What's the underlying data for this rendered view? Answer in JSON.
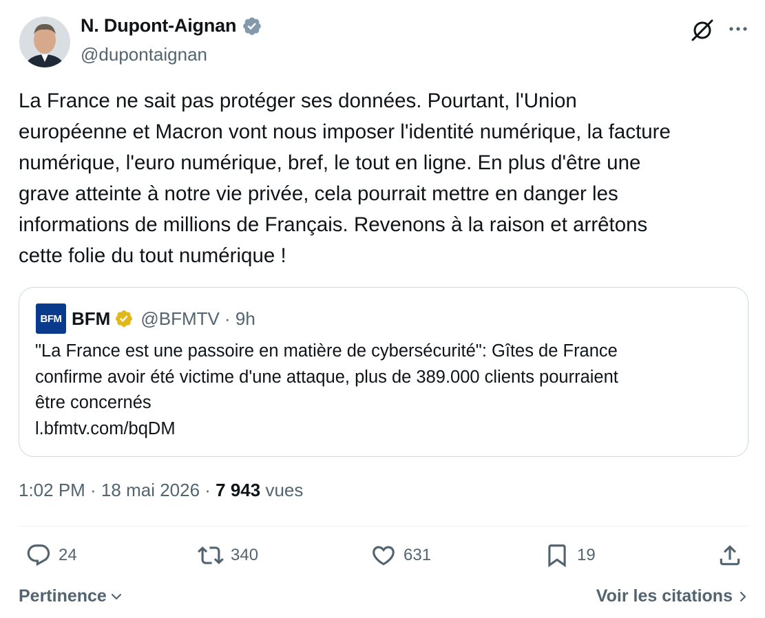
{
  "author": {
    "name": "N. Dupont-Aignan",
    "handle": "@dupontaignan"
  },
  "tweet": {
    "text": "La France ne sait pas protéger ses données. Pourtant, l'Union\neuropéenne et Macron vont nous imposer l'identité numérique, la facture\nnumérique, l'euro numérique, bref, le tout en ligne. En plus d'être une\ngrave atteinte à notre vie privée, cela pourrait mettre en danger les\ninformations de millions de Français. Revenons à la raison et arrêtons\ncette folie du tout numérique !"
  },
  "quote": {
    "logo_text": "BFM",
    "name": "BFM",
    "meta": "@BFMTV · 9h",
    "text": "\"La France est une passoire en matière de cybersécurité\": Gîtes de France\nconfirme avoir été victime d'une attaque, plus de 389.000 clients pourraient\nêtre concernés",
    "link": "l.bfmtv.com/bqDM"
  },
  "meta": {
    "time_date": "1:02 PM · 18 mai 2026 · ",
    "views": "7 943",
    "views_label": "vues"
  },
  "actions": {
    "replies": "24",
    "reposts": "340",
    "likes": "631",
    "bookmarks": "19"
  },
  "footer": {
    "sort_label": "Pertinence",
    "quotes_label": "Voir les citations"
  },
  "colors": {
    "verified_blue": "#829aab",
    "verified_gold": "#e2b719",
    "secondary_text": "#536471",
    "bfm_blue": "#0a3a8c"
  },
  "icons": [
    "grok-icon",
    "more-icon",
    "verified-badge",
    "reply-icon",
    "repost-icon",
    "like-icon",
    "bookmark-icon",
    "share-icon",
    "chevron-down-icon",
    "chevron-right-icon"
  ]
}
